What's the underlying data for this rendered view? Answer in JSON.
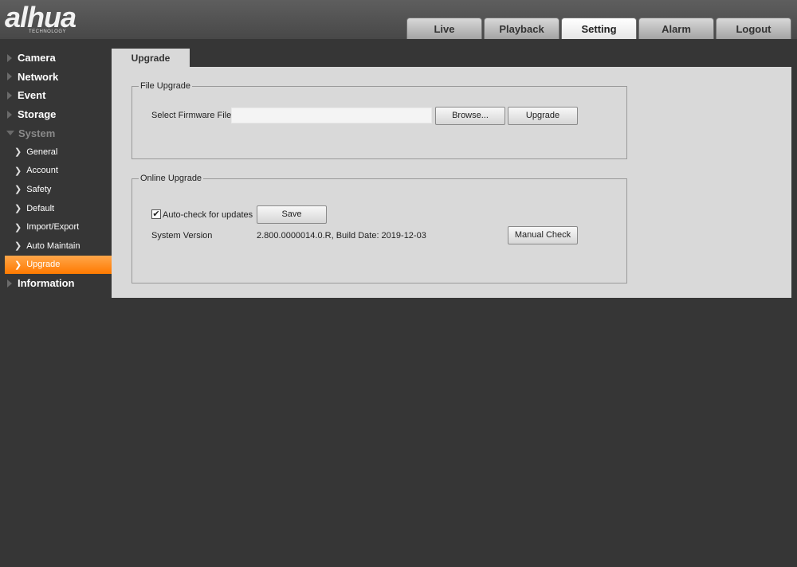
{
  "header": {
    "logo_text": "alhua",
    "logo_subtext": "TECHNOLOGY",
    "tabs": [
      {
        "label": "Live",
        "active": false
      },
      {
        "label": "Playback",
        "active": false
      },
      {
        "label": "Setting",
        "active": true
      },
      {
        "label": "Alarm",
        "active": false
      },
      {
        "label": "Logout",
        "active": false
      }
    ]
  },
  "sidebar": {
    "items": [
      {
        "label": "Camera"
      },
      {
        "label": "Network"
      },
      {
        "label": "Event"
      },
      {
        "label": "Storage"
      },
      {
        "label": "System",
        "expanded": true
      },
      {
        "label": "General"
      },
      {
        "label": "Account"
      },
      {
        "label": "Safety"
      },
      {
        "label": "Default"
      },
      {
        "label": "Import/Export"
      },
      {
        "label": "Auto Maintain"
      },
      {
        "label": "Upgrade",
        "active": true
      },
      {
        "label": "Information"
      }
    ]
  },
  "main": {
    "page_tab": "Upgrade",
    "file_upgrade": {
      "legend": "File Upgrade",
      "select_label": "Select Firmware File",
      "file_value": "",
      "browse_label": "Browse...",
      "upgrade_label": "Upgrade"
    },
    "online_upgrade": {
      "legend": "Online Upgrade",
      "autocheck_label": "Auto-check for updates",
      "autocheck_checked": true,
      "checkmark": "✔",
      "save_label": "Save",
      "version_label": "System Version",
      "version_value": "2.800.0000014.0.R, Build Date: 2019-12-03",
      "manual_check_label": "Manual Check"
    }
  },
  "colors": {
    "accent": "#ff8c1a",
    "background": "#363636",
    "panel": "#d9d9d9"
  }
}
